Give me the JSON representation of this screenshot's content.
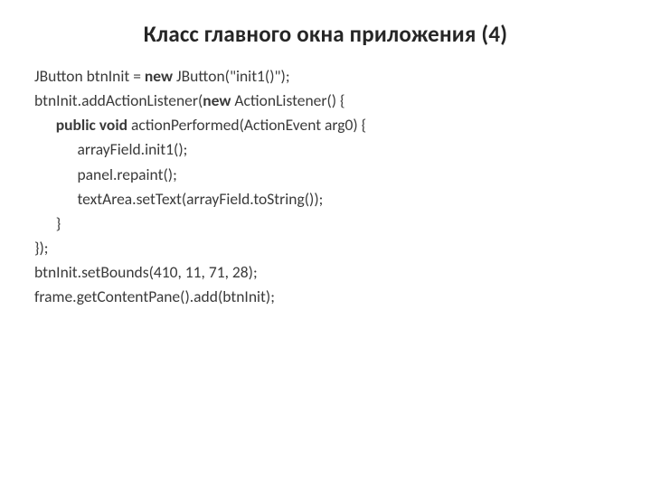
{
  "title": "Класс главного окна приложения (4)",
  "code": {
    "l1a": "JButton btnInit = ",
    "l1b": "new",
    "l1c": " JButton(\"init1()\");",
    "l2a": "btnInit.addActionListener(",
    "l2b": "new",
    "l2c": " ActionListener() {",
    "l3a": "      ",
    "l3b": "public void",
    "l3c": " actionPerformed(ActionEvent arg0) {",
    "l4": "            arrayField.init1();",
    "l5": "            panel.repaint();",
    "l6": "            textArea.setText(arrayField.toString());",
    "l7": "      }",
    "l8": "});",
    "l9": "btnInit.setBounds(410, 11, 71, 28);",
    "l10": "frame.getContentPane().add(btnInit);"
  }
}
